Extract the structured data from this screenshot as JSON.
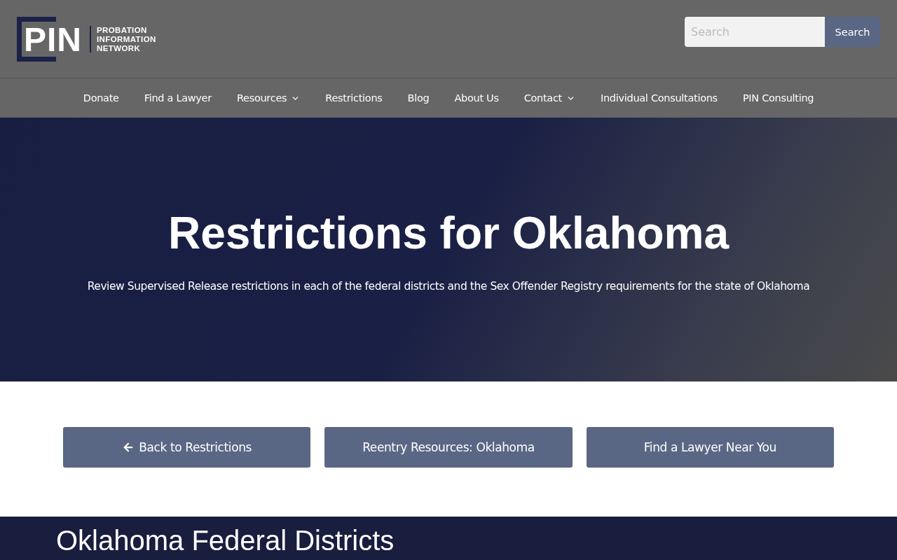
{
  "logo": {
    "mark": "PIN",
    "lines": [
      "PROBATION",
      "INFORMATION",
      "NETWORK"
    ]
  },
  "search": {
    "placeholder": "Search",
    "button": "Search"
  },
  "nav": [
    {
      "label": "Donate",
      "has_dropdown": false
    },
    {
      "label": "Find a Lawyer",
      "has_dropdown": false
    },
    {
      "label": "Resources",
      "has_dropdown": true
    },
    {
      "label": "Restrictions",
      "has_dropdown": false
    },
    {
      "label": "Blog",
      "has_dropdown": false
    },
    {
      "label": "About Us",
      "has_dropdown": false
    },
    {
      "label": "Contact",
      "has_dropdown": true
    },
    {
      "label": "Individual Consultations",
      "has_dropdown": false
    },
    {
      "label": "PIN Consulting",
      "has_dropdown": false
    }
  ],
  "hero": {
    "title": "Restrictions for Oklahoma",
    "subtitle": "Review Supervised Release restrictions in each of the federal districts and the Sex Offender Registry requirements for the state of Oklahoma"
  },
  "buttons": [
    {
      "label": "Back to Restrictions",
      "kind": "back"
    },
    {
      "label": "Reentry Resources: Oklahoma",
      "kind": "plain"
    },
    {
      "label": "Find a Lawyer Near You",
      "kind": "plain"
    }
  ],
  "section": {
    "title": "Oklahoma Federal Districts"
  }
}
